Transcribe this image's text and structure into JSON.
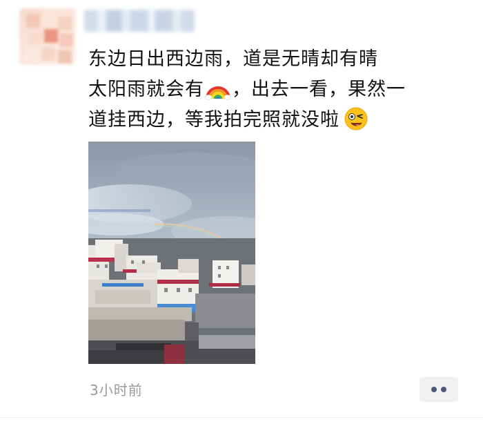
{
  "post": {
    "author_avatar": "blurred-avatar",
    "author_name_blurred": true,
    "text_line1": "东边日出西边雨，道是无晴却有晴",
    "text_line2_before": "太阳雨就会有",
    "text_line2_after": "，出去一看，果然一",
    "text_line3": "道挂西边，等我拍完照就没啦",
    "emoji_rainbow": "rainbow-emoji",
    "emoji_wink": "winking-face-emoji",
    "photo": "sky-with-rainbow-over-buildings",
    "timestamp": "3小时前"
  },
  "actions": {
    "more_icon": "more-dots-icon"
  },
  "colors": {
    "text": "#111111",
    "timestamp": "#9a9a9a",
    "more_button_bg": "#f1f1f3",
    "more_button_dots": "#4c5a7a"
  }
}
